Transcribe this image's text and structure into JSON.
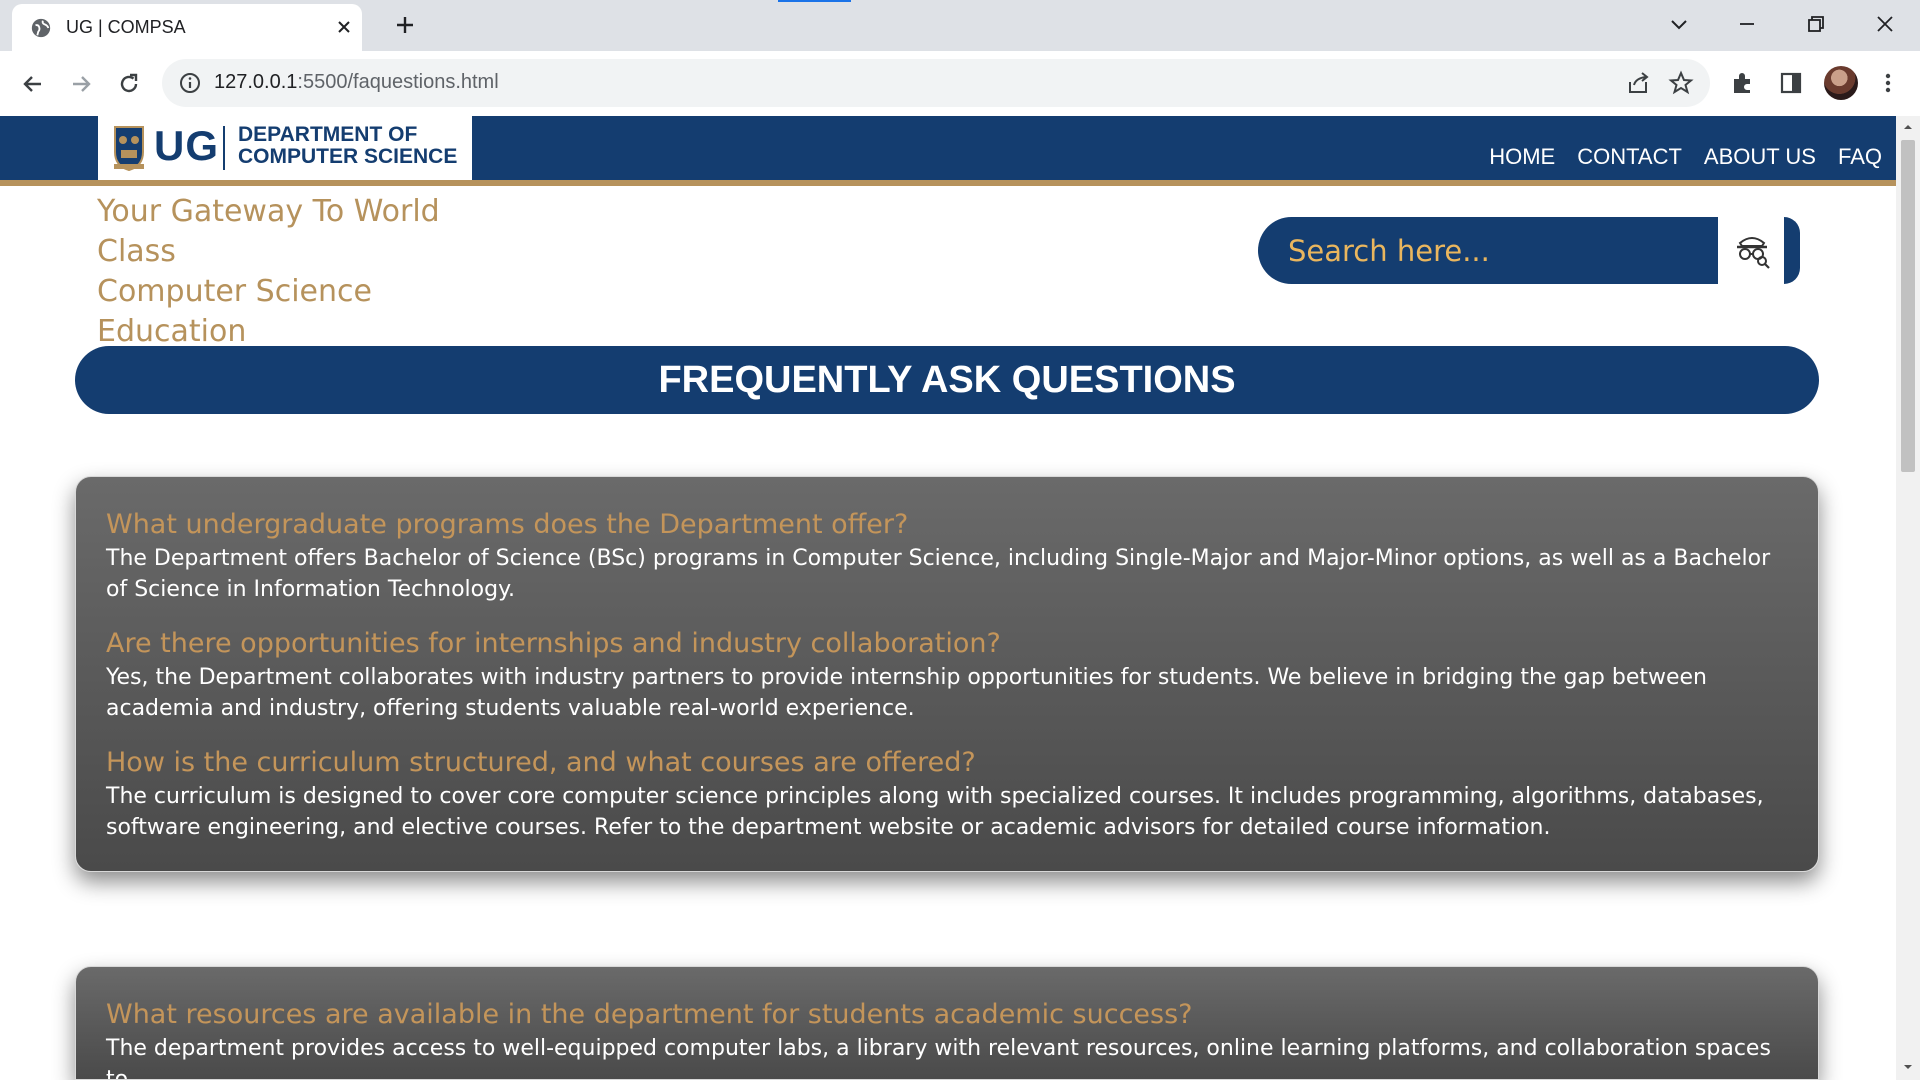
{
  "browser": {
    "tab_title": "UG | COMPSA",
    "url_host": "127.0.0.1",
    "url_rest": ":5500/faquestions.html"
  },
  "header": {
    "logo_ug": "UG",
    "logo_dept_line1": "DEPARTMENT OF",
    "logo_dept_line2": "COMPUTER SCIENCE",
    "nav": [
      "HOME",
      "CONTACT",
      "ABOUT US",
      "FAQ"
    ]
  },
  "tagline": {
    "line1": "Your Gateway To World Class",
    "line2": "Computer Science",
    "line3": "Education"
  },
  "search": {
    "placeholder": "Search here..."
  },
  "banner": {
    "title": "FREQUENTLY ASK QUESTIONS"
  },
  "faq_cards": [
    {
      "items": [
        {
          "question": "What undergraduate programs does the Department offer?",
          "answer": "The Department offers Bachelor of Science (BSc) programs in Computer Science, including Single-Major and Major-Minor options, as well as a Bachelor of Science in Information Technology."
        },
        {
          "question": "Are there opportunities for internships and industry collaboration?",
          "answer": "Yes, the Department collaborates with industry partners to provide internship opportunities for students. We believe in bridging the gap between academia and industry, offering students valuable real-world experience."
        },
        {
          "question": "How is the curriculum structured, and what courses are offered?",
          "answer": "The curriculum is designed to cover core computer science principles along with specialized courses. It includes programming, algorithms, databases, software engineering, and elective courses. Refer to the department website or academic advisors for detailed course information."
        }
      ]
    },
    {
      "items": [
        {
          "question": "What resources are available in the department for students academic success?",
          "answer": "The department provides access to well-equipped computer labs, a library with relevant resources, online learning platforms, and collaboration spaces to"
        }
      ]
    }
  ],
  "colors": {
    "navy": "#143d70",
    "gold": "#b6925c",
    "card_gray": "#5a5a5a"
  }
}
